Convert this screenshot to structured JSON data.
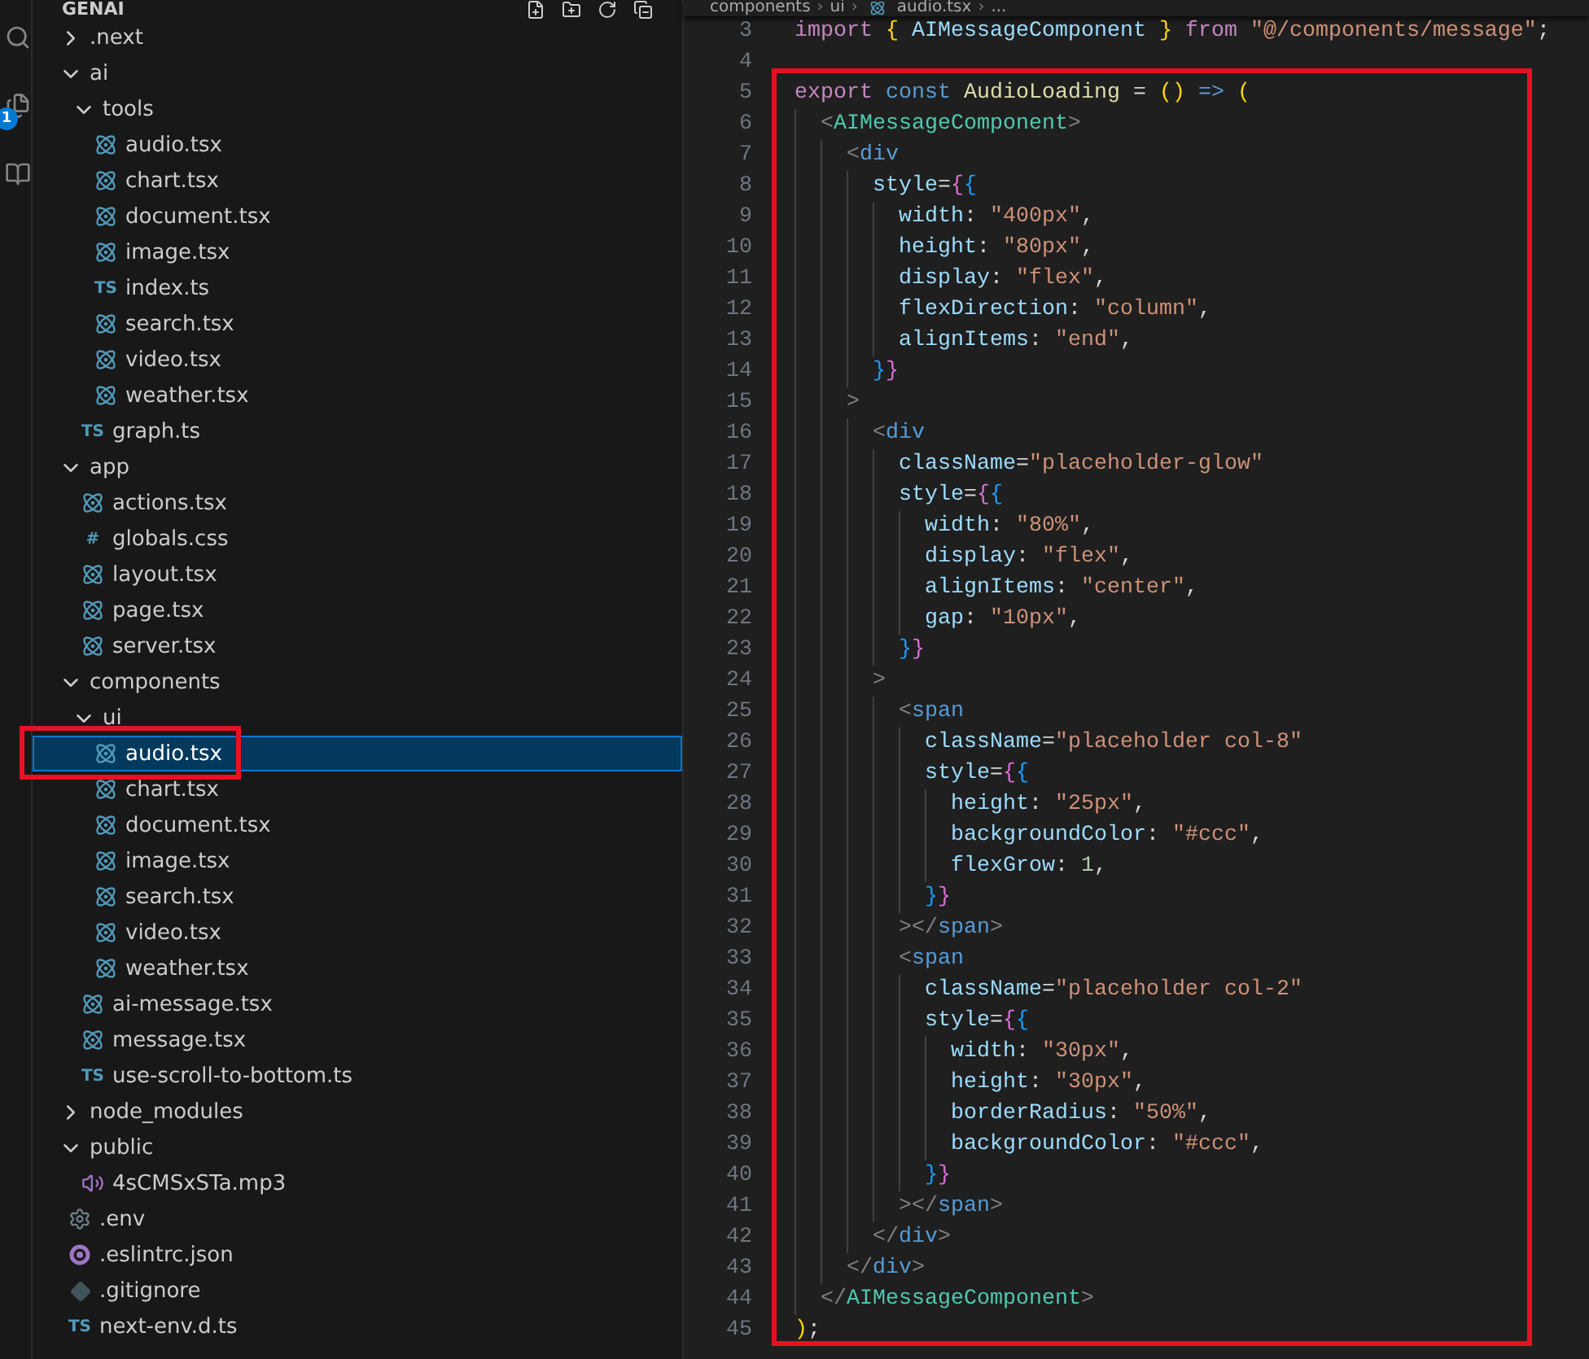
{
  "activity_bar": {
    "badge": "1"
  },
  "explorer": {
    "title": "GENAI",
    "tree": [
      {
        "name": ".next",
        "kind": "folder",
        "expanded": false,
        "selected": false
      },
      {
        "name": "ai",
        "kind": "folder",
        "expanded": true,
        "selected": false,
        "children": [
          {
            "name": "tools",
            "kind": "folder",
            "expanded": true,
            "selected": false,
            "children": [
              {
                "name": "audio.tsx",
                "kind": "react",
                "selected": false
              },
              {
                "name": "chart.tsx",
                "kind": "react",
                "selected": false
              },
              {
                "name": "document.tsx",
                "kind": "react",
                "selected": false
              },
              {
                "name": "image.tsx",
                "kind": "react",
                "selected": false
              },
              {
                "name": "index.ts",
                "kind": "ts",
                "icon_text": "TS",
                "selected": false
              },
              {
                "name": "search.tsx",
                "kind": "react",
                "selected": false
              },
              {
                "name": "video.tsx",
                "kind": "react",
                "selected": false
              },
              {
                "name": "weather.tsx",
                "kind": "react",
                "selected": false
              }
            ]
          },
          {
            "name": "graph.ts",
            "kind": "ts",
            "icon_text": "TS",
            "selected": false
          }
        ]
      },
      {
        "name": "app",
        "kind": "folder",
        "expanded": true,
        "selected": false,
        "children": [
          {
            "name": "actions.tsx",
            "kind": "react",
            "selected": false
          },
          {
            "name": "globals.css",
            "kind": "css",
            "icon_text": "#",
            "selected": false
          },
          {
            "name": "layout.tsx",
            "kind": "react",
            "selected": false
          },
          {
            "name": "page.tsx",
            "kind": "react",
            "selected": false
          },
          {
            "name": "server.tsx",
            "kind": "react",
            "selected": false
          }
        ]
      },
      {
        "name": "components",
        "kind": "folder",
        "expanded": true,
        "selected": false,
        "children": [
          {
            "name": "ui",
            "kind": "folder",
            "expanded": true,
            "selected": false,
            "children": [
              {
                "name": "audio.tsx",
                "kind": "react",
                "selected": true
              },
              {
                "name": "chart.tsx",
                "kind": "react",
                "selected": false
              },
              {
                "name": "document.tsx",
                "kind": "react",
                "selected": false
              },
              {
                "name": "image.tsx",
                "kind": "react",
                "selected": false
              },
              {
                "name": "search.tsx",
                "kind": "react",
                "selected": false
              },
              {
                "name": "video.tsx",
                "kind": "react",
                "selected": false
              },
              {
                "name": "weather.tsx",
                "kind": "react",
                "selected": false
              }
            ]
          },
          {
            "name": "ai-message.tsx",
            "kind": "react",
            "selected": false
          },
          {
            "name": "message.tsx",
            "kind": "react",
            "selected": false
          },
          {
            "name": "use-scroll-to-bottom.ts",
            "kind": "ts",
            "icon_text": "TS",
            "selected": false
          }
        ]
      },
      {
        "name": "node_modules",
        "kind": "folder",
        "expanded": false,
        "selected": false
      },
      {
        "name": "public",
        "kind": "folder",
        "expanded": true,
        "selected": false,
        "children": [
          {
            "name": "4sCMSxSTa.mp3",
            "kind": "audio",
            "selected": false
          }
        ]
      },
      {
        "name": ".env",
        "kind": "env",
        "selected": false
      },
      {
        "name": ".eslintrc.json",
        "kind": "eslint",
        "selected": false
      },
      {
        "name": ".gitignore",
        "kind": "git",
        "selected": false
      },
      {
        "name": "next-env.d.ts",
        "kind": "ts",
        "icon_text": "TS",
        "selected": false
      }
    ]
  },
  "breadcrumb": {
    "separator": "›",
    "items": [
      "components",
      "ui",
      "audio.tsx",
      "..."
    ]
  },
  "code": [
    {
      "number": "3",
      "tokens": [
        {
          "kind": "keyword",
          "text": "import "
        },
        {
          "kind": "b1",
          "text": "{"
        },
        {
          "kind": "var",
          "text": " AIMessageComponent "
        },
        {
          "kind": "b1",
          "text": "}"
        },
        {
          "kind": "keyword",
          "text": " from "
        },
        {
          "kind": "string",
          "text": "\"@/components/message\""
        },
        {
          "kind": "plain",
          "text": ";"
        }
      ]
    },
    {
      "number": "4"
    },
    {
      "number": "5",
      "tokens": [
        {
          "kind": "keyword",
          "text": "export "
        },
        {
          "kind": "storage",
          "text": "const "
        },
        {
          "kind": "function",
          "text": "AudioLoading"
        },
        {
          "kind": "plain",
          "text": " = "
        },
        {
          "kind": "b1",
          "text": "()"
        },
        {
          "kind": "storage",
          "text": " => "
        },
        {
          "kind": "b1",
          "text": "("
        }
      ]
    },
    {
      "number": "6",
      "tokens": [
        {
          "kind": "angle",
          "text": "  <"
        },
        {
          "kind": "component",
          "text": "AIMessageComponent"
        },
        {
          "kind": "angle",
          "text": ">"
        }
      ]
    },
    {
      "number": "7",
      "tokens": [
        {
          "kind": "angle",
          "text": "    <"
        },
        {
          "kind": "tag",
          "text": "div"
        }
      ]
    },
    {
      "number": "8",
      "tokens": [
        {
          "kind": "attr",
          "text": "      style"
        },
        {
          "kind": "plain",
          "text": "="
        },
        {
          "kind": "b2",
          "text": "{"
        },
        {
          "kind": "b3",
          "text": "{"
        }
      ]
    },
    {
      "number": "9",
      "tokens": [
        {
          "kind": "attr",
          "text": "        width"
        },
        {
          "kind": "plain",
          "text": ": "
        },
        {
          "kind": "string",
          "text": "\"400px\""
        },
        {
          "kind": "plain",
          "text": ","
        }
      ]
    },
    {
      "number": "10",
      "tokens": [
        {
          "kind": "attr",
          "text": "        height"
        },
        {
          "kind": "plain",
          "text": ": "
        },
        {
          "kind": "string",
          "text": "\"80px\""
        },
        {
          "kind": "plain",
          "text": ","
        }
      ]
    },
    {
      "number": "11",
      "tokens": [
        {
          "kind": "attr",
          "text": "        display"
        },
        {
          "kind": "plain",
          "text": ": "
        },
        {
          "kind": "string",
          "text": "\"flex\""
        },
        {
          "kind": "plain",
          "text": ","
        }
      ]
    },
    {
      "number": "12",
      "tokens": [
        {
          "kind": "attr",
          "text": "        flexDirection"
        },
        {
          "kind": "plain",
          "text": ": "
        },
        {
          "kind": "string",
          "text": "\"column\""
        },
        {
          "kind": "plain",
          "text": ","
        }
      ]
    },
    {
      "number": "13",
      "tokens": [
        {
          "kind": "attr",
          "text": "        alignItems"
        },
        {
          "kind": "plain",
          "text": ": "
        },
        {
          "kind": "string",
          "text": "\"end\""
        },
        {
          "kind": "plain",
          "text": ","
        }
      ]
    },
    {
      "number": "14",
      "tokens": [
        {
          "kind": "b3",
          "text": "      }"
        },
        {
          "kind": "b2",
          "text": "}"
        }
      ]
    },
    {
      "number": "15",
      "tokens": [
        {
          "kind": "angle",
          "text": "    >"
        }
      ]
    },
    {
      "number": "16",
      "tokens": [
        {
          "kind": "angle",
          "text": "      <"
        },
        {
          "kind": "tag",
          "text": "div"
        }
      ]
    },
    {
      "number": "17",
      "tokens": [
        {
          "kind": "attr",
          "text": "        className"
        },
        {
          "kind": "plain",
          "text": "="
        },
        {
          "kind": "string",
          "text": "\"placeholder-glow\""
        }
      ]
    },
    {
      "number": "18",
      "tokens": [
        {
          "kind": "attr",
          "text": "        style"
        },
        {
          "kind": "plain",
          "text": "="
        },
        {
          "kind": "b2",
          "text": "{"
        },
        {
          "kind": "b3",
          "text": "{"
        }
      ]
    },
    {
      "number": "19",
      "tokens": [
        {
          "kind": "attr",
          "text": "          width"
        },
        {
          "kind": "plain",
          "text": ": "
        },
        {
          "kind": "string",
          "text": "\"80%\""
        },
        {
          "kind": "plain",
          "text": ","
        }
      ]
    },
    {
      "number": "20",
      "tokens": [
        {
          "kind": "attr",
          "text": "          display"
        },
        {
          "kind": "plain",
          "text": ": "
        },
        {
          "kind": "string",
          "text": "\"flex\""
        },
        {
          "kind": "plain",
          "text": ","
        }
      ]
    },
    {
      "number": "21",
      "tokens": [
        {
          "kind": "attr",
          "text": "          alignItems"
        },
        {
          "kind": "plain",
          "text": ": "
        },
        {
          "kind": "string",
          "text": "\"center\""
        },
        {
          "kind": "plain",
          "text": ","
        }
      ]
    },
    {
      "number": "22",
      "tokens": [
        {
          "kind": "attr",
          "text": "          gap"
        },
        {
          "kind": "plain",
          "text": ": "
        },
        {
          "kind": "string",
          "text": "\"10px\""
        },
        {
          "kind": "plain",
          "text": ","
        }
      ]
    },
    {
      "number": "23",
      "tokens": [
        {
          "kind": "b3",
          "text": "        }"
        },
        {
          "kind": "b2",
          "text": "}"
        }
      ]
    },
    {
      "number": "24",
      "tokens": [
        {
          "kind": "angle",
          "text": "      >"
        }
      ]
    },
    {
      "number": "25",
      "tokens": [
        {
          "kind": "angle",
          "text": "        <"
        },
        {
          "kind": "tag",
          "text": "span"
        }
      ]
    },
    {
      "number": "26",
      "tokens": [
        {
          "kind": "attr",
          "text": "          className"
        },
        {
          "kind": "plain",
          "text": "="
        },
        {
          "kind": "string",
          "text": "\"placeholder col-8\""
        }
      ]
    },
    {
      "number": "27",
      "tokens": [
        {
          "kind": "attr",
          "text": "          style"
        },
        {
          "kind": "plain",
          "text": "="
        },
        {
          "kind": "b2",
          "text": "{"
        },
        {
          "kind": "b3",
          "text": "{"
        }
      ]
    },
    {
      "number": "28",
      "tokens": [
        {
          "kind": "attr",
          "text": "            height"
        },
        {
          "kind": "plain",
          "text": ": "
        },
        {
          "kind": "string",
          "text": "\"25px\""
        },
        {
          "kind": "plain",
          "text": ","
        }
      ]
    },
    {
      "number": "29",
      "tokens": [
        {
          "kind": "attr",
          "text": "            backgroundColor"
        },
        {
          "kind": "plain",
          "text": ": "
        },
        {
          "kind": "string",
          "text": "\"#ccc\""
        },
        {
          "kind": "plain",
          "text": ","
        }
      ]
    },
    {
      "number": "30",
      "tokens": [
        {
          "kind": "attr",
          "text": "            flexGrow"
        },
        {
          "kind": "plain",
          "text": ": "
        },
        {
          "kind": "number",
          "text": "1"
        },
        {
          "kind": "plain",
          "text": ","
        }
      ]
    },
    {
      "number": "31",
      "tokens": [
        {
          "kind": "b3",
          "text": "          }"
        },
        {
          "kind": "b2",
          "text": "}"
        }
      ]
    },
    {
      "number": "32",
      "tokens": [
        {
          "kind": "angle",
          "text": "        ></"
        },
        {
          "kind": "tag",
          "text": "span"
        },
        {
          "kind": "angle",
          "text": ">"
        }
      ]
    },
    {
      "number": "33",
      "tokens": [
        {
          "kind": "angle",
          "text": "        <"
        },
        {
          "kind": "tag",
          "text": "span"
        }
      ]
    },
    {
      "number": "34",
      "tokens": [
        {
          "kind": "attr",
          "text": "          className"
        },
        {
          "kind": "plain",
          "text": "="
        },
        {
          "kind": "string",
          "text": "\"placeholder col-2\""
        }
      ]
    },
    {
      "number": "35",
      "tokens": [
        {
          "kind": "attr",
          "text": "          style"
        },
        {
          "kind": "plain",
          "text": "="
        },
        {
          "kind": "b2",
          "text": "{"
        },
        {
          "kind": "b3",
          "text": "{"
        }
      ]
    },
    {
      "number": "36",
      "tokens": [
        {
          "kind": "attr",
          "text": "            width"
        },
        {
          "kind": "plain",
          "text": ": "
        },
        {
          "kind": "string",
          "text": "\"30px\""
        },
        {
          "kind": "plain",
          "text": ","
        }
      ]
    },
    {
      "number": "37",
      "tokens": [
        {
          "kind": "attr",
          "text": "            height"
        },
        {
          "kind": "plain",
          "text": ": "
        },
        {
          "kind": "string",
          "text": "\"30px\""
        },
        {
          "kind": "plain",
          "text": ","
        }
      ]
    },
    {
      "number": "38",
      "tokens": [
        {
          "kind": "attr",
          "text": "            borderRadius"
        },
        {
          "kind": "plain",
          "text": ": "
        },
        {
          "kind": "string",
          "text": "\"50%\""
        },
        {
          "kind": "plain",
          "text": ","
        }
      ]
    },
    {
      "number": "39",
      "tokens": [
        {
          "kind": "attr",
          "text": "            backgroundColor"
        },
        {
          "kind": "plain",
          "text": ": "
        },
        {
          "kind": "string",
          "text": "\"#ccc\""
        },
        {
          "kind": "plain",
          "text": ","
        }
      ]
    },
    {
      "number": "40",
      "tokens": [
        {
          "kind": "b3",
          "text": "          }"
        },
        {
          "kind": "b2",
          "text": "}"
        }
      ]
    },
    {
      "number": "41",
      "tokens": [
        {
          "kind": "angle",
          "text": "        ></"
        },
        {
          "kind": "tag",
          "text": "span"
        },
        {
          "kind": "angle",
          "text": ">"
        }
      ]
    },
    {
      "number": "42",
      "tokens": [
        {
          "kind": "angle",
          "text": "      </"
        },
        {
          "kind": "tag",
          "text": "div"
        },
        {
          "kind": "angle",
          "text": ">"
        }
      ]
    },
    {
      "number": "43",
      "tokens": [
        {
          "kind": "angle",
          "text": "    </"
        },
        {
          "kind": "tag",
          "text": "div"
        },
        {
          "kind": "angle",
          "text": ">"
        }
      ]
    },
    {
      "number": "44",
      "tokens": [
        {
          "kind": "angle",
          "text": "  </"
        },
        {
          "kind": "component",
          "text": "AIMessageComponent"
        },
        {
          "kind": "angle",
          "text": ">"
        }
      ]
    },
    {
      "number": "45",
      "tokens": [
        {
          "kind": "b1",
          "text": ")"
        },
        {
          "kind": "plain",
          "text": ";"
        }
      ]
    }
  ]
}
